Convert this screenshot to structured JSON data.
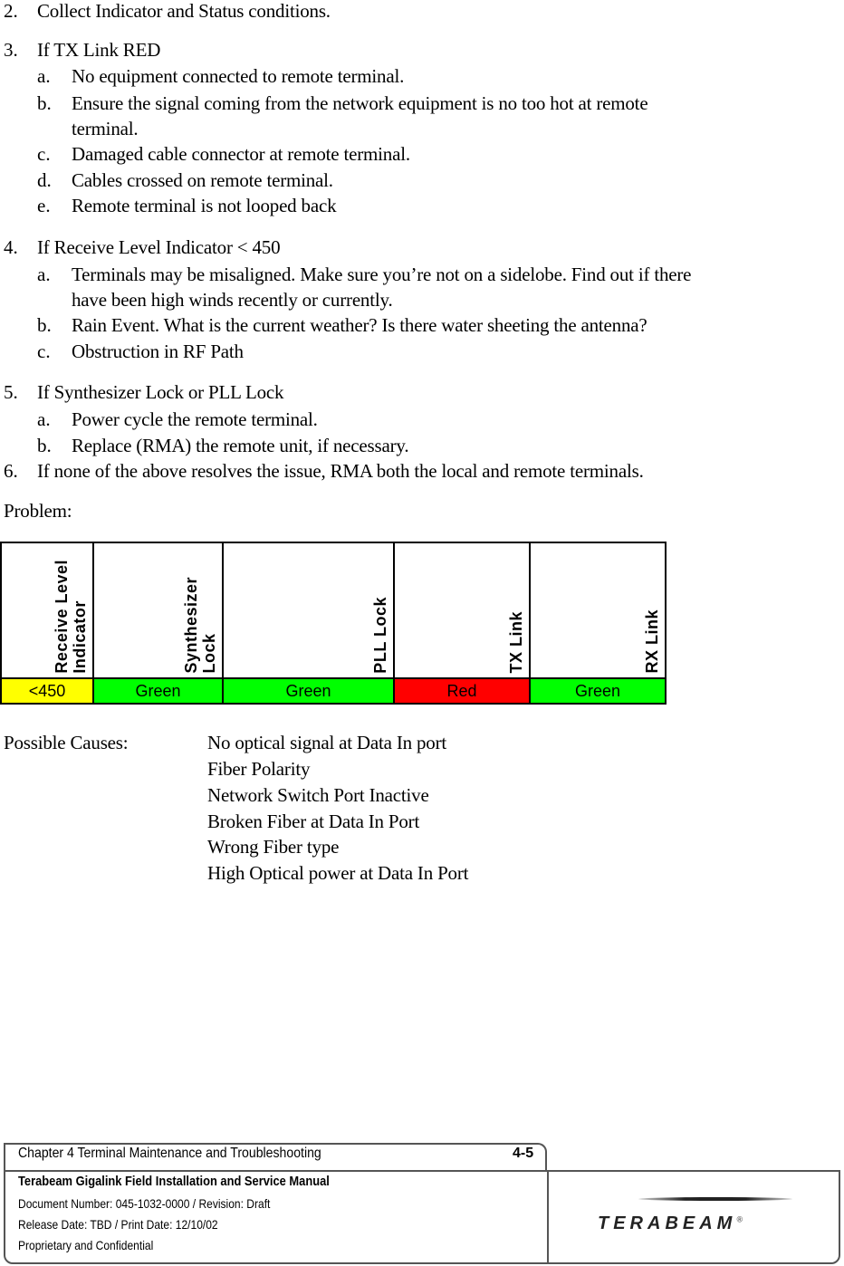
{
  "steps": [
    {
      "num": "2.",
      "text": "Collect Indicator and Status conditions.",
      "subs": []
    },
    {
      "num": "3.",
      "text": "If TX Link RED",
      "subs": [
        {
          "letter": "a.",
          "lines": [
            "No equipment connected to remote terminal."
          ]
        },
        {
          "letter": "b.",
          "lines": [
            "Ensure the signal coming from the network equipment is no too hot at remote",
            "terminal."
          ]
        },
        {
          "letter": "c.",
          "lines": [
            "Damaged cable connector at remote terminal."
          ]
        },
        {
          "letter": "d.",
          "lines": [
            "Cables crossed on remote terminal."
          ]
        },
        {
          "letter": "e.",
          "lines": [
            "Remote terminal is not looped back"
          ]
        }
      ]
    },
    {
      "num": "4.",
      "text": "If Receive Level Indicator < 450",
      "subs": [
        {
          "letter": "a.",
          "lines": [
            "Terminals may be misaligned.  Make sure you’re not on a sidelobe.  Find out if there",
            "have been high winds recently or currently."
          ]
        },
        {
          "letter": "b.",
          "lines": [
            "Rain Event.  What is the current weather?  Is there water sheeting the antenna?"
          ]
        },
        {
          "letter": "c.",
          "lines": [
            "Obstruction in RF Path"
          ]
        }
      ]
    },
    {
      "num": "5.",
      "text": "If Synthesizer Lock or PLL Lock",
      "subs": [
        {
          "letter": "a.",
          "lines": [
            "Power cycle the remote terminal."
          ]
        },
        {
          "letter": "b.",
          "lines": [
            "Replace (RMA) the remote unit, if necessary."
          ]
        }
      ]
    },
    {
      "num": "6.",
      "text": "If none of the above resolves the issue, RMA both the local and remote terminals.",
      "subs": []
    }
  ],
  "problem_label": "Problem:",
  "status_table": {
    "headers": [
      "Receive Level Indicator",
      "Synthesizer Lock",
      "PLL Lock",
      "TX Link",
      "RX Link"
    ],
    "header_lines": [
      [
        "Receive Level",
        "Indicator"
      ],
      [
        "Synthesizer",
        "Lock"
      ],
      [
        "PLL Lock"
      ],
      [
        "TX Link"
      ],
      [
        "RX Link"
      ]
    ],
    "values": [
      "<450",
      "Green",
      "Green",
      "Red",
      "Green"
    ],
    "colors": [
      "#ffff00",
      "#00ff00",
      "#00ff00",
      "#ff0000",
      "#00ff00"
    ]
  },
  "possible_causes": {
    "label": "Possible Causes:",
    "items": [
      "No optical signal at Data In port",
      "Fiber Polarity",
      "Network Switch Port Inactive",
      "Broken Fiber at Data In Port",
      "Wrong Fiber type",
      "High Optical power at Data In Port"
    ]
  },
  "footer": {
    "chapter": "Chapter 4  Terminal Maintenance and Troubleshooting",
    "page": "4-5",
    "manual_title": "Terabeam Gigalink Field Installation and Service Manual",
    "doc_number": "Document Number:  045-1032-0000 / Revision:  Draft",
    "dates": "Release Date:  TBD / Print Date:  12/10/02",
    "confidential": "Proprietary and Confidential",
    "logo_text": "TERABEAM",
    "logo_mark": "®"
  }
}
